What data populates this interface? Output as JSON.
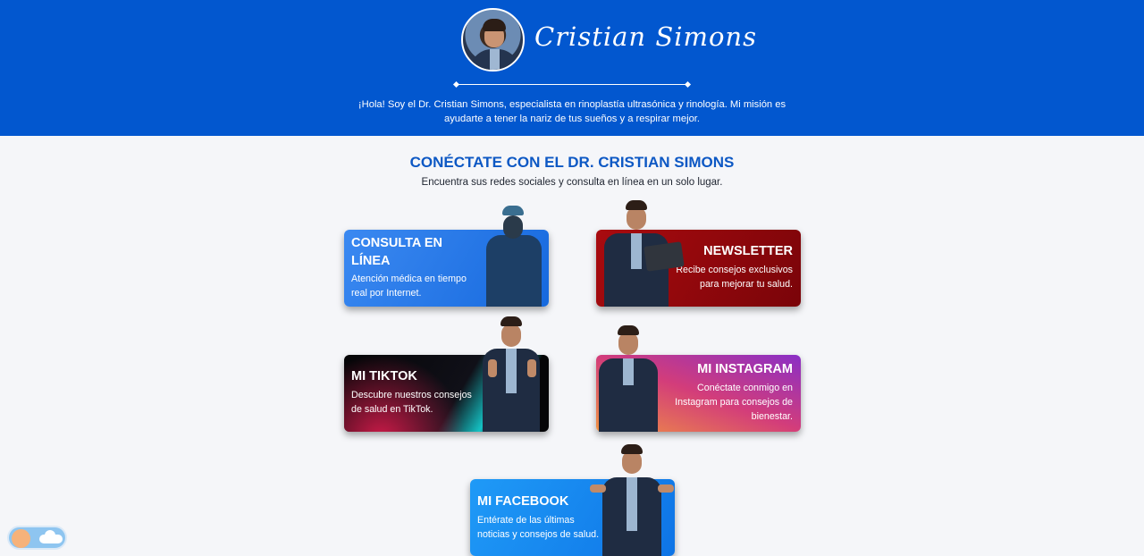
{
  "header": {
    "signature": "Cristian Simons",
    "intro_line1": "¡Hola! Soy el Dr. Cristian Simons, especialista en rinoplastía ultrasónica y rinología. Mi misión es",
    "intro_line2": "ayudarte a tener la nariz de tus sueños y a respirar mejor."
  },
  "section": {
    "title": "CONÉCTATE CON EL DR. CRISTIAN SIMONS",
    "subtitle": "Encuentra sus redes sociales y consulta en línea en un solo lugar."
  },
  "cards": {
    "consulta": {
      "title_line1": "CONSULTA EN",
      "title_line2": "LÍNEA",
      "desc_line1": "Atención médica en tiempo",
      "desc_line2": "real por Internet."
    },
    "newsletter": {
      "title": "NEWSLETTER",
      "desc_line1": "Recibe consejos exclusivos",
      "desc_line2": "para mejorar tu salud."
    },
    "tiktok": {
      "title": "MI TIKTOK",
      "desc_line1": "Descubre nuestros consejos",
      "desc_line2": "de salud en TikTok."
    },
    "instagram": {
      "title": "MI INSTAGRAM",
      "desc_line1": "Conéctate conmigo en",
      "desc_line2": "Instagram para consejos de",
      "desc_line3": "bienestar."
    },
    "facebook": {
      "title": "MI FACEBOOK",
      "desc_line1": "Entérate de las últimas",
      "desc_line2": "noticias y consejos de salud."
    }
  },
  "colors": {
    "hero_blue": "#0257cf",
    "heading_blue": "#0d58c4",
    "newsletter_red": "#a90b0f",
    "facebook_blue": "#1f9af7"
  },
  "theme_toggle": {
    "icons": [
      "sun-icon",
      "cloud-icon"
    ]
  }
}
